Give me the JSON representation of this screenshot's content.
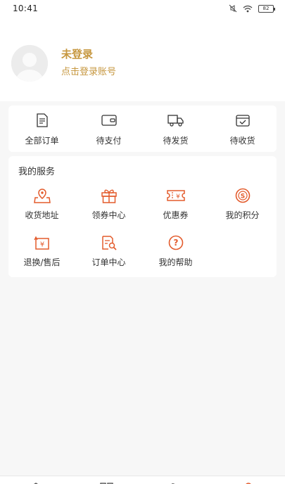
{
  "status_bar": {
    "time": "10:41",
    "battery": "82",
    "icons": [
      "mute-icon",
      "wifi-icon",
      "battery-icon"
    ]
  },
  "profile": {
    "title": "未登录",
    "subtitle": "点击登录账号",
    "accent_color": "#c6973f"
  },
  "orders": {
    "items": [
      {
        "label": "全部订单",
        "icon": "document-icon"
      },
      {
        "label": "待支付",
        "icon": "wallet-icon"
      },
      {
        "label": "待发货",
        "icon": "truck-icon"
      },
      {
        "label": "待收货",
        "icon": "box-check-icon"
      }
    ]
  },
  "services": {
    "title": "我的服务",
    "icon_color": "#e35b2c",
    "items": [
      {
        "label": "收货地址",
        "icon": "location-icon"
      },
      {
        "label": "领券中心",
        "icon": "gift-icon"
      },
      {
        "label": "优惠券",
        "icon": "coupon-icon"
      },
      {
        "label": "我的积分",
        "icon": "points-coin-icon"
      },
      {
        "label": "退换/售后",
        "icon": "refund-icon"
      },
      {
        "label": "订单中心",
        "icon": "order-search-icon"
      },
      {
        "label": "我的帮助",
        "icon": "help-icon"
      }
    ]
  },
  "bottom_nav": {
    "items": [
      "home-icon",
      "category-icon",
      "cart-icon",
      "profile-icon"
    ],
    "active_color": "#e35b2c"
  }
}
